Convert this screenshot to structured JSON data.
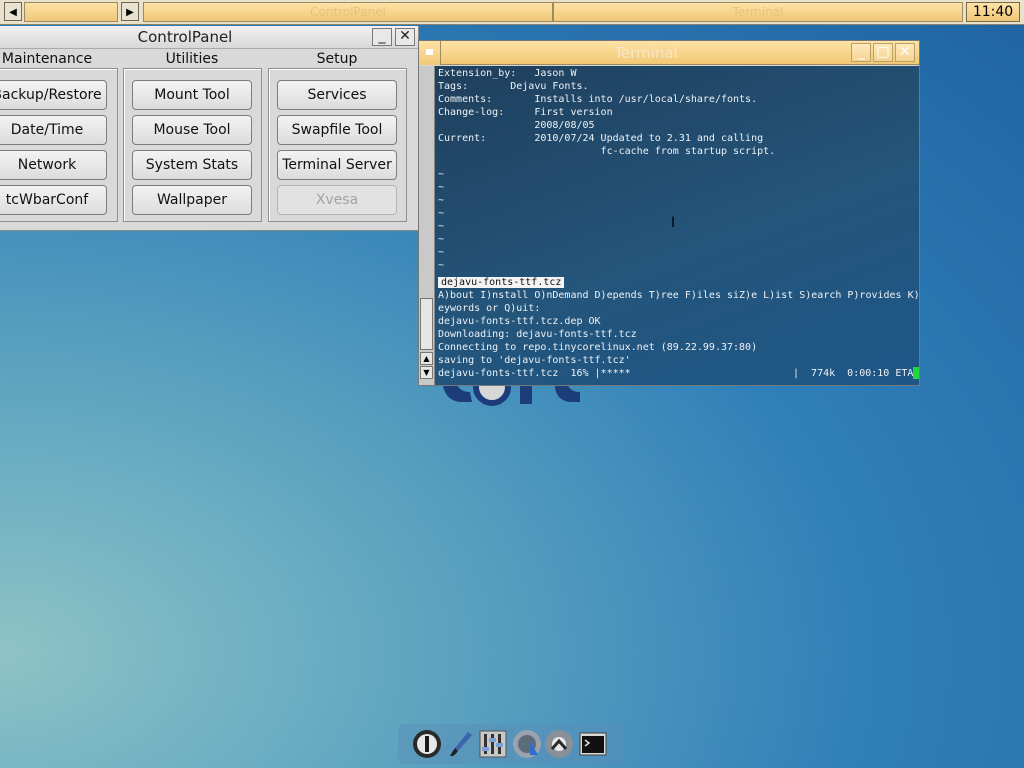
{
  "taskbar": {
    "left_arrow": "◀",
    "right_arrow": "▶",
    "task1": "",
    "task2": "ControlPanel",
    "task3": "Terminal",
    "clock": "11:40"
  },
  "control_panel": {
    "title": "ControlPanel",
    "minimize": "_",
    "close": "✕",
    "columns": [
      {
        "heading": "Maintenance",
        "buttons": [
          "Backup/Restore",
          "Date/Time",
          "Network",
          "tcWbarConf"
        ]
      },
      {
        "heading": "Utilities",
        "buttons": [
          "Mount Tool",
          "Mouse Tool",
          "System Stats",
          "Wallpaper"
        ]
      },
      {
        "heading": "Setup",
        "buttons": [
          "Services",
          "Swapfile Tool",
          "Terminal Server",
          "Xvesa"
        ]
      }
    ]
  },
  "terminal": {
    "title": "Terminal",
    "lines": [
      "Extension_by:   Jason W",
      "Tags:       Dejavu Fonts.",
      "Comments:       Installs into /usr/local/share/fonts.",
      "Change-log:     First version",
      "                2008/08/05",
      "Current:        2010/07/24 Updated to 2.31 and calling",
      "                           fc-cache from startup script.",
      "",
      "~",
      "~",
      "~",
      "~",
      "~",
      "~",
      "~",
      "~"
    ],
    "prompt_file": "dejavu-fonts-ttf.tcz",
    "menu_line1": "A)bout I)nstall O)nDemand D)epends T)ree F)iles siZ)e L)ist S)earch P)rovides K)",
    "menu_line2": "eywords or Q)uit:",
    "output": [
      "dejavu-fonts-ttf.tcz.dep OK",
      "Downloading: dejavu-fonts-ttf.tcz",
      "Connecting to repo.tinycorelinux.net (89.22.99.37:80)",
      "saving to 'dejavu-fonts-ttf.tcz'"
    ],
    "progress_left": "dejavu-fonts-ttf.tcz  16% |*****",
    "progress_right": "|  774k  0:00:10 ETA"
  },
  "colors": {
    "taskbar_accent": "#f0c777",
    "terminal_bg": "#24557b",
    "cursor": "#22d73a"
  },
  "dock": {
    "icons": [
      "power-icon",
      "paint-brush-icon",
      "control-panel-icon",
      "apps-install-icon",
      "settings-run-icon",
      "terminal-icon"
    ]
  }
}
